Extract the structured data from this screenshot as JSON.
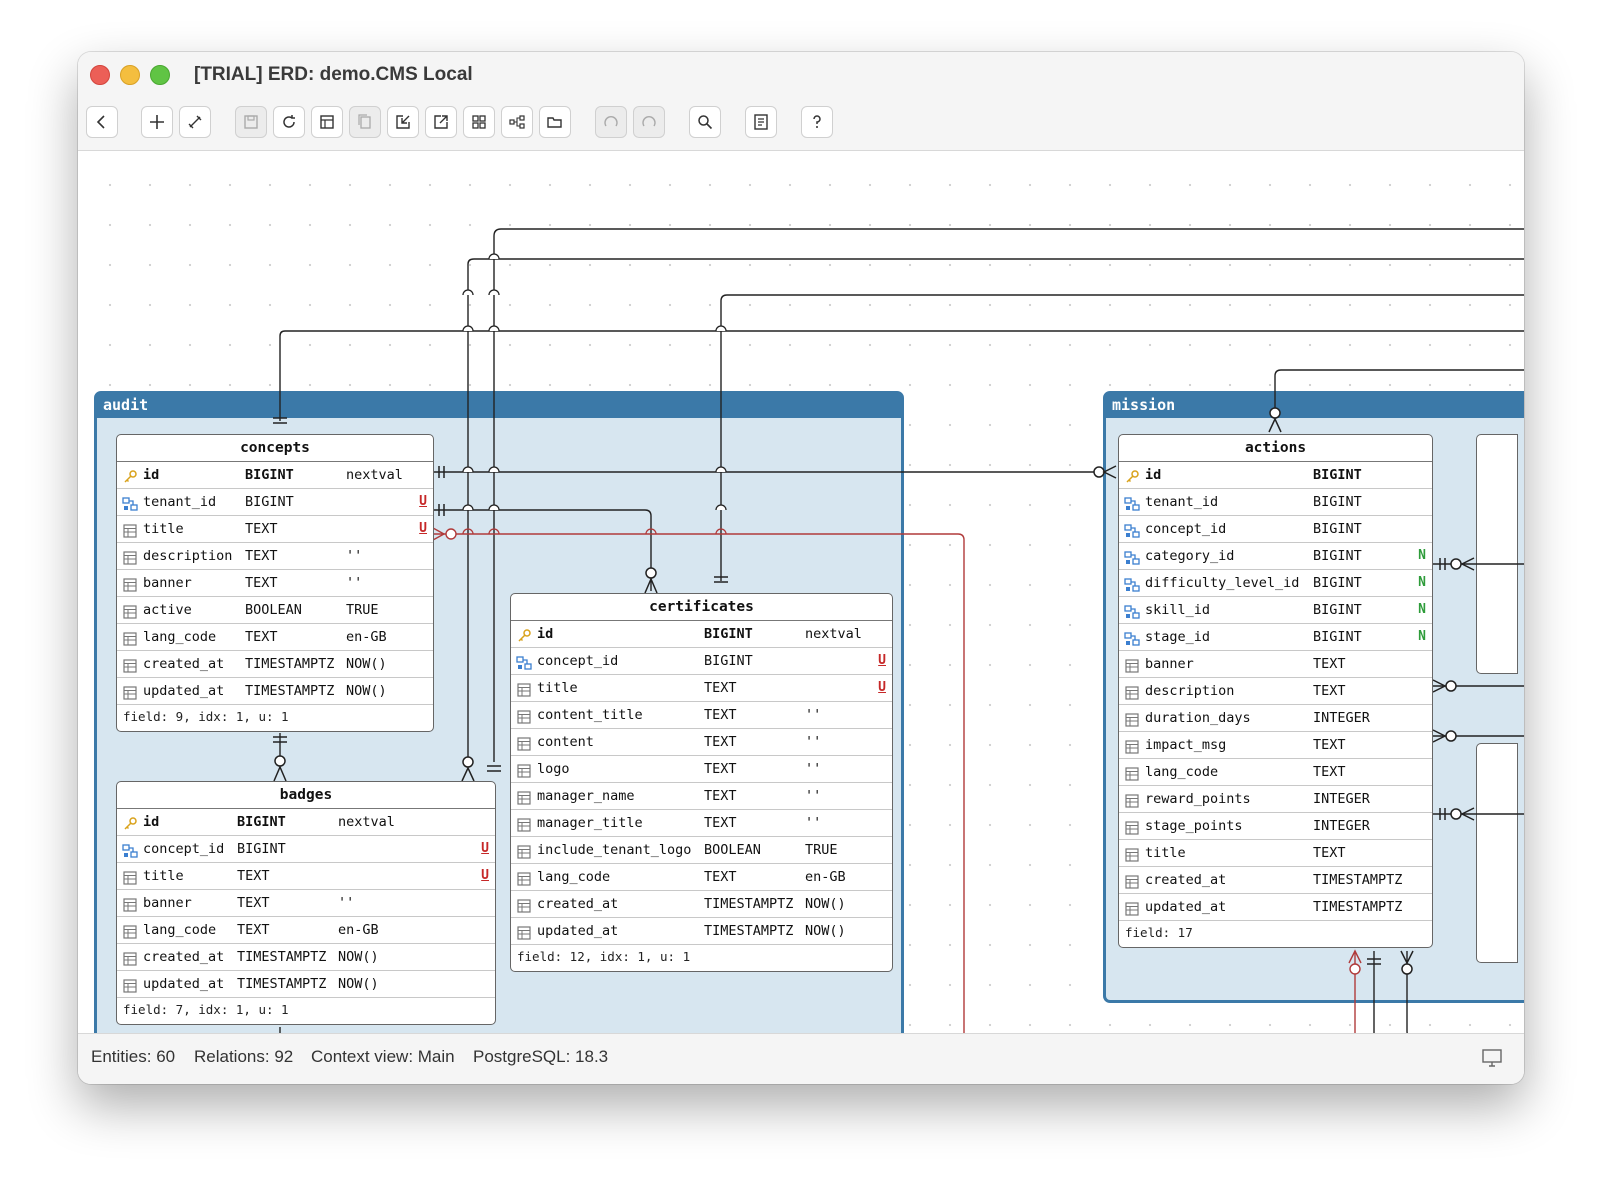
{
  "window": {
    "title": "[TRIAL] ERD: demo.CMS Local"
  },
  "toolbar": {
    "buttons": [
      {
        "name": "back-button",
        "icon": "chevron-left-icon"
      },
      {
        "name": "add-button",
        "icon": "plus-icon"
      },
      {
        "name": "link-button",
        "icon": "link-icon"
      },
      {
        "name": "save-button",
        "icon": "save-icon",
        "disabled": true
      },
      {
        "name": "refresh-button",
        "icon": "refresh-icon"
      },
      {
        "name": "layout-button",
        "icon": "layout-icon"
      },
      {
        "name": "copy-button",
        "icon": "copy-icon",
        "disabled": true
      },
      {
        "name": "import-button",
        "icon": "import-icon"
      },
      {
        "name": "export-button",
        "icon": "export-icon"
      },
      {
        "name": "grid-button",
        "icon": "grid-icon"
      },
      {
        "name": "diagram-button",
        "icon": "diagram-icon"
      },
      {
        "name": "open-folder-button",
        "icon": "folder-icon"
      },
      {
        "name": "undo-button",
        "icon": "undo-icon",
        "disabled": true
      },
      {
        "name": "redo-button",
        "icon": "redo-icon",
        "disabled": true
      },
      {
        "name": "search-button",
        "icon": "search-icon"
      },
      {
        "name": "properties-button",
        "icon": "properties-icon"
      },
      {
        "name": "help-button",
        "icon": "help-icon"
      }
    ]
  },
  "contexts": {
    "audit": {
      "label": "audit"
    },
    "mission": {
      "label": "mission"
    }
  },
  "entities": {
    "concepts": {
      "name": "concepts",
      "fields": [
        {
          "name": "id",
          "type": "BIGINT",
          "default": "nextval",
          "flag": "",
          "kind": "pk"
        },
        {
          "name": "tenant_id",
          "type": "BIGINT",
          "default": "",
          "flag": "U",
          "kind": "fk"
        },
        {
          "name": "title",
          "type": "TEXT",
          "default": "",
          "flag": "U",
          "kind": "col"
        },
        {
          "name": "description",
          "type": "TEXT",
          "default": "''",
          "flag": "",
          "kind": "col"
        },
        {
          "name": "banner",
          "type": "TEXT",
          "default": "''",
          "flag": "",
          "kind": "col"
        },
        {
          "name": "active",
          "type": "BOOLEAN",
          "default": "TRUE",
          "flag": "",
          "kind": "col"
        },
        {
          "name": "lang_code",
          "type": "TEXT",
          "default": "en-GB",
          "flag": "",
          "kind": "col"
        },
        {
          "name": "created_at",
          "type": "TIMESTAMPTZ",
          "default": "NOW()",
          "flag": "",
          "kind": "col"
        },
        {
          "name": "updated_at",
          "type": "TIMESTAMPTZ",
          "default": "NOW()",
          "flag": "",
          "kind": "col"
        }
      ],
      "footer": "field: 9, idx: 1, u: 1"
    },
    "badges": {
      "name": "badges",
      "fields": [
        {
          "name": "id",
          "type": "BIGINT",
          "default": "nextval",
          "flag": "",
          "kind": "pk"
        },
        {
          "name": "concept_id",
          "type": "BIGINT",
          "default": "",
          "flag": "U",
          "kind": "fk"
        },
        {
          "name": "title",
          "type": "TEXT",
          "default": "",
          "flag": "U",
          "kind": "col"
        },
        {
          "name": "banner",
          "type": "TEXT",
          "default": "''",
          "flag": "",
          "kind": "col"
        },
        {
          "name": "lang_code",
          "type": "TEXT",
          "default": "en-GB",
          "flag": "",
          "kind": "col"
        },
        {
          "name": "created_at",
          "type": "TIMESTAMPTZ",
          "default": "NOW()",
          "flag": "",
          "kind": "col"
        },
        {
          "name": "updated_at",
          "type": "TIMESTAMPTZ",
          "default": "NOW()",
          "flag": "",
          "kind": "col"
        }
      ],
      "footer": "field: 7, idx: 1, u: 1"
    },
    "certificates": {
      "name": "certificates",
      "fields": [
        {
          "name": "id",
          "type": "BIGINT",
          "default": "nextval",
          "flag": "",
          "kind": "pk"
        },
        {
          "name": "concept_id",
          "type": "BIGINT",
          "default": "",
          "flag": "U",
          "kind": "fk"
        },
        {
          "name": "title",
          "type": "TEXT",
          "default": "",
          "flag": "U",
          "kind": "col"
        },
        {
          "name": "content_title",
          "type": "TEXT",
          "default": "''",
          "flag": "",
          "kind": "col"
        },
        {
          "name": "content",
          "type": "TEXT",
          "default": "''",
          "flag": "",
          "kind": "col"
        },
        {
          "name": "logo",
          "type": "TEXT",
          "default": "''",
          "flag": "",
          "kind": "col"
        },
        {
          "name": "manager_name",
          "type": "TEXT",
          "default": "''",
          "flag": "",
          "kind": "col"
        },
        {
          "name": "manager_title",
          "type": "TEXT",
          "default": "''",
          "flag": "",
          "kind": "col"
        },
        {
          "name": "include_tenant_logo",
          "type": "BOOLEAN",
          "default": "TRUE",
          "flag": "",
          "kind": "col"
        },
        {
          "name": "lang_code",
          "type": "TEXT",
          "default": "en-GB",
          "flag": "",
          "kind": "col"
        },
        {
          "name": "created_at",
          "type": "TIMESTAMPTZ",
          "default": "NOW()",
          "flag": "",
          "kind": "col"
        },
        {
          "name": "updated_at",
          "type": "TIMESTAMPTZ",
          "default": "NOW()",
          "flag": "",
          "kind": "col"
        }
      ],
      "footer": "field: 12, idx: 1, u: 1"
    },
    "actions": {
      "name": "actions",
      "fields": [
        {
          "name": "id",
          "type": "BIGINT",
          "default": "",
          "flag": "",
          "kind": "pk"
        },
        {
          "name": "tenant_id",
          "type": "BIGINT",
          "default": "",
          "flag": "",
          "kind": "fk"
        },
        {
          "name": "concept_id",
          "type": "BIGINT",
          "default": "",
          "flag": "",
          "kind": "fk"
        },
        {
          "name": "category_id",
          "type": "BIGINT",
          "default": "",
          "flag": "N",
          "kind": "fk"
        },
        {
          "name": "difficulty_level_id",
          "type": "BIGINT",
          "default": "",
          "flag": "N",
          "kind": "fk"
        },
        {
          "name": "skill_id",
          "type": "BIGINT",
          "default": "",
          "flag": "N",
          "kind": "fk"
        },
        {
          "name": "stage_id",
          "type": "BIGINT",
          "default": "",
          "flag": "N",
          "kind": "fk"
        },
        {
          "name": "banner",
          "type": "TEXT",
          "default": "",
          "flag": "",
          "kind": "col"
        },
        {
          "name": "description",
          "type": "TEXT",
          "default": "",
          "flag": "",
          "kind": "col"
        },
        {
          "name": "duration_days",
          "type": "INTEGER",
          "default": "",
          "flag": "",
          "kind": "col"
        },
        {
          "name": "impact_msg",
          "type": "TEXT",
          "default": "",
          "flag": "",
          "kind": "col"
        },
        {
          "name": "lang_code",
          "type": "TEXT",
          "default": "",
          "flag": "",
          "kind": "col"
        },
        {
          "name": "reward_points",
          "type": "INTEGER",
          "default": "",
          "flag": "",
          "kind": "col"
        },
        {
          "name": "stage_points",
          "type": "INTEGER",
          "default": "",
          "flag": "",
          "kind": "col"
        },
        {
          "name": "title",
          "type": "TEXT",
          "default": "",
          "flag": "",
          "kind": "col"
        },
        {
          "name": "created_at",
          "type": "TIMESTAMPTZ",
          "default": "",
          "flag": "",
          "kind": "col"
        },
        {
          "name": "updated_at",
          "type": "TIMESTAMPTZ",
          "default": "",
          "flag": "",
          "kind": "col"
        }
      ],
      "footer": "field: 17"
    }
  },
  "status": {
    "entities": "Entities: 60",
    "relations": "Relations: 92",
    "context": "Context view: Main",
    "db": "PostgreSQL: 18.3"
  },
  "colors": {
    "context_border": "#3b79a8",
    "context_fill": "#d7e6f0",
    "relation_line": "#222222",
    "optional_relation_line": "#b03a3a",
    "unique_flag": "#c62828",
    "nullable_flag": "#2e9c3a"
  }
}
